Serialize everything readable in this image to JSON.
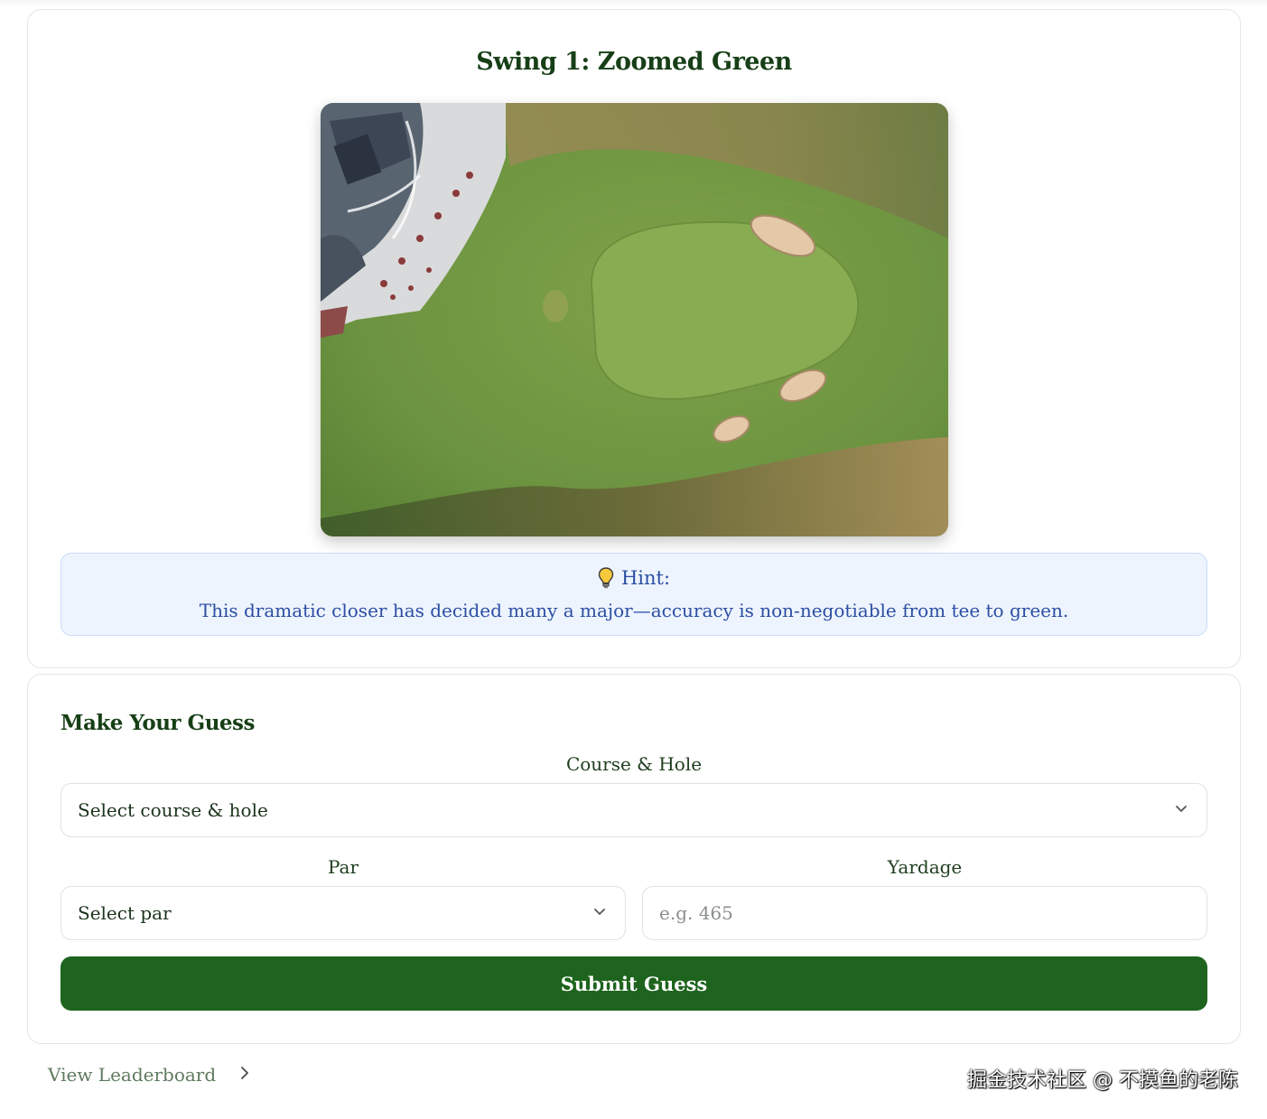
{
  "swing": {
    "title": "Swing 1: Zoomed Green",
    "image_alt": "aerial-golf-green"
  },
  "hint": {
    "icon": "lightbulb-icon",
    "label": "Hint:",
    "text": "This dramatic closer has decided many a major—accuracy is non-negotiable from tee to green."
  },
  "guess": {
    "title": "Make Your Guess",
    "course_label": "Course & Hole",
    "course_value": "Select course & hole",
    "par_label": "Par",
    "par_value": "Select par",
    "yardage_label": "Yardage",
    "yardage_placeholder": "e.g. 465",
    "submit_label": "Submit Guess"
  },
  "footer": {
    "leaderboard_label": "View Leaderboard",
    "watermark": "掘金技术社区 @ 不摸鱼的老陈"
  },
  "colors": {
    "primary_green": "#1e641e",
    "hint_bg": "#edf4fe",
    "hint_text": "#2c4ea3"
  }
}
